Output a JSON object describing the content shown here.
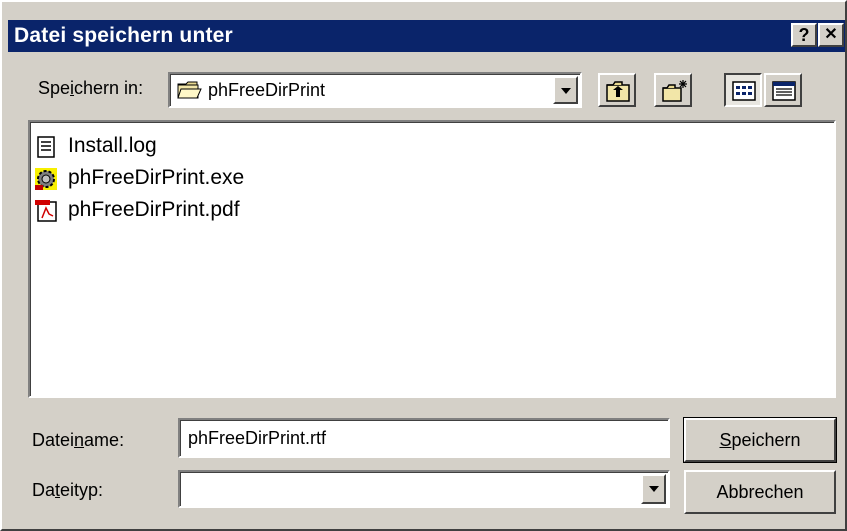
{
  "window": {
    "title": "Datei speichern unter",
    "help_glyph": "?",
    "close_glyph": "✕"
  },
  "location": {
    "label_pre": "Spe",
    "label_ul": "i",
    "label_post": "chern in:",
    "current": "phFreeDirPrint"
  },
  "files": [
    {
      "name": "Install.log",
      "icon": "text-file-icon"
    },
    {
      "name": "phFreeDirPrint.exe",
      "icon": "application-gear-icon"
    },
    {
      "name": "phFreeDirPrint.pdf",
      "icon": "pdf-file-icon"
    }
  ],
  "filename": {
    "label_pre": "Datei",
    "label_ul": "n",
    "label_post": "ame:",
    "value": "phFreeDirPrint.rtf"
  },
  "filetype": {
    "label_pre": "Da",
    "label_ul": "t",
    "label_post": "eityp:",
    "value": ""
  },
  "buttons": {
    "save_ul": "S",
    "save_post": "peichern",
    "cancel": "Abbrechen"
  },
  "colors": {
    "titlebar": "#0a246a",
    "face": "#d4d0c8"
  }
}
